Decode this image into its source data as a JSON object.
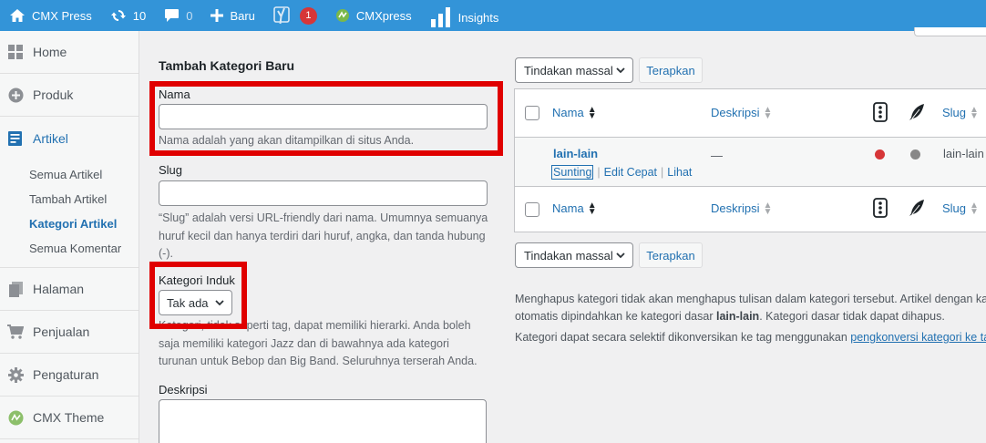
{
  "adminbar": {
    "site_name": "CMX Press",
    "updates_count": "10",
    "comments_count": "0",
    "new_label": "Baru",
    "yoast_badge": "1",
    "cmxpress_label": "CMXpress",
    "insights_label": "Insights"
  },
  "sidebar": {
    "home": "Home",
    "produk": "Produk",
    "artikel": "Artikel",
    "submenu": {
      "semua_artikel": "Semua Artikel",
      "tambah_artikel": "Tambah Artikel",
      "kategori_artikel": "Kategori Artikel",
      "semua_komentar": "Semua Komentar"
    },
    "halaman": "Halaman",
    "penjualan": "Penjualan",
    "pengaturan": "Pengaturan",
    "cmx_theme": "CMX Theme"
  },
  "form": {
    "title": "Tambah Kategori Baru",
    "name_label": "Nama",
    "name_help": "Nama adalah yang akan ditampilkan di situs Anda.",
    "slug_label": "Slug",
    "slug_help_1": "“Slug” adalah versi URL-friendly dari nama. Umumnya semuanya",
    "slug_help_2": "huruf kecil dan hanya terdiri dari huruf, angka, dan tanda hubung",
    "slug_help_3": "(-).",
    "parent_label": "Kategori Induk",
    "parent_value": "Tak ada",
    "parent_help_1": "Kategori, tidak seperti tag, dapat memiliki hierarki. Anda boleh",
    "parent_help_2": "saja memiliki kategori Jazz dan di bawahnya ada kategori",
    "parent_help_3": "turunan untuk Bebop dan Big Band. Seluruhnya terserah Anda.",
    "description_label": "Deskripsi"
  },
  "table": {
    "bulk_action": "Tindakan massal",
    "apply": "Terapkan",
    "col_name": "Nama",
    "col_description": "Deskripsi",
    "col_slug": "Slug",
    "rows": [
      {
        "name": "lain-lain",
        "description": "—",
        "slug": "lain-lain",
        "action_edit": "Sunting",
        "action_quick_edit": "Edit Cepat",
        "action_view": "Lihat"
      }
    ]
  },
  "notes": {
    "line1": "Menghapus kategori tidak akan menghapus tulisan dalam kategori tersebut. Artikel dengan ka",
    "line2_pre": "otomatis dipindahkan ke kategori dasar ",
    "line2_bold": "lain-lain",
    "line2_post": ". Kategori dasar tidak dapat dihapus.",
    "line3_pre": "Kategori dapat secara selektif dikonversikan ke tag menggunakan ",
    "line3_link": "pengkonversi kategori ke ta"
  },
  "colors": {
    "adminbar": "#3394d8",
    "link": "#2271b1",
    "highlight_box": "#e00000",
    "seo_red": "#d63638",
    "readability_grey": "#888888"
  }
}
